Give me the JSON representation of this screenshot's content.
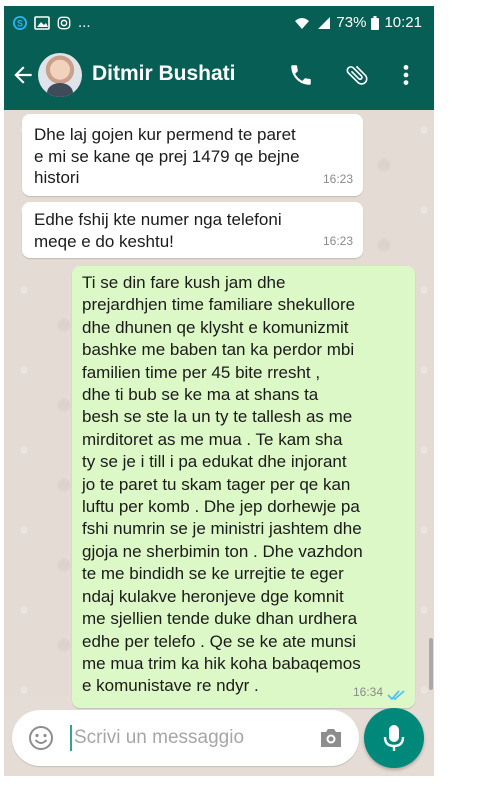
{
  "status_bar": {
    "battery": "73%",
    "time": "10:21",
    "notification_more": "..."
  },
  "app_bar": {
    "contact_name": "Ditmir Bushati",
    "icons": [
      "back-arrow-icon",
      "phone-icon",
      "attach-icon",
      "more-vert-icon"
    ]
  },
  "messages": [
    {
      "direction": "incoming",
      "lines": [
        "Dhe laj gojen kur permend te paret",
        "e mi se kane qe prej 1479 qe bejne",
        "histori"
      ],
      "time": "16:23"
    },
    {
      "direction": "incoming",
      "lines": [
        "Edhe fshij kte numer nga telefoni",
        "meqe e do keshtu!"
      ],
      "time": "16:23"
    },
    {
      "direction": "outgoing",
      "lines": [
        "Ti se din fare kush jam dhe",
        "prejardhjen time familiare shekullore",
        "dhe dhunen qe klysht e komunizmit",
        "bashke me baben tan ka perdor mbi",
        "familien time per 45 bite rresht ,",
        "dhe ti bub  se ke ma at shans ta",
        "besh  se ste la un ty  te tallesh as me",
        "mirditoret as me mua . Te kam sha",
        "ty se je i till i pa edukat dhe injorant",
        "jo te paret tu skam tager per qe kan",
        "luftu per komb . Dhe jep dorhewje pa",
        "fshi numrin se je ministri jashtem dhe",
        "gjoja ne sherbimin ton  . Dhe vazhdon",
        "te me bindidh se ke urrejtie te eger",
        "ndaj kulakve heronjeve dge komnit",
        "me sjellien tende duke dhan urdhera",
        "edhe per telefo . Qe se ke ate munsi",
        "me mua trim ka hik koha babaqemos",
        "e komunistave re ndyr ."
      ],
      "time": "16:34",
      "status": "read"
    }
  ],
  "composer": {
    "placeholder": "Scrivi un messaggio",
    "icons": [
      "emoji-icon",
      "camera-icon",
      "mic-icon"
    ]
  },
  "colors": {
    "header": "#075e54",
    "incoming_bubble": "#ffffff",
    "outgoing_bubble": "#dcf8c6",
    "read_ticks": "#4fc3f7",
    "mic_button": "#00897b"
  }
}
